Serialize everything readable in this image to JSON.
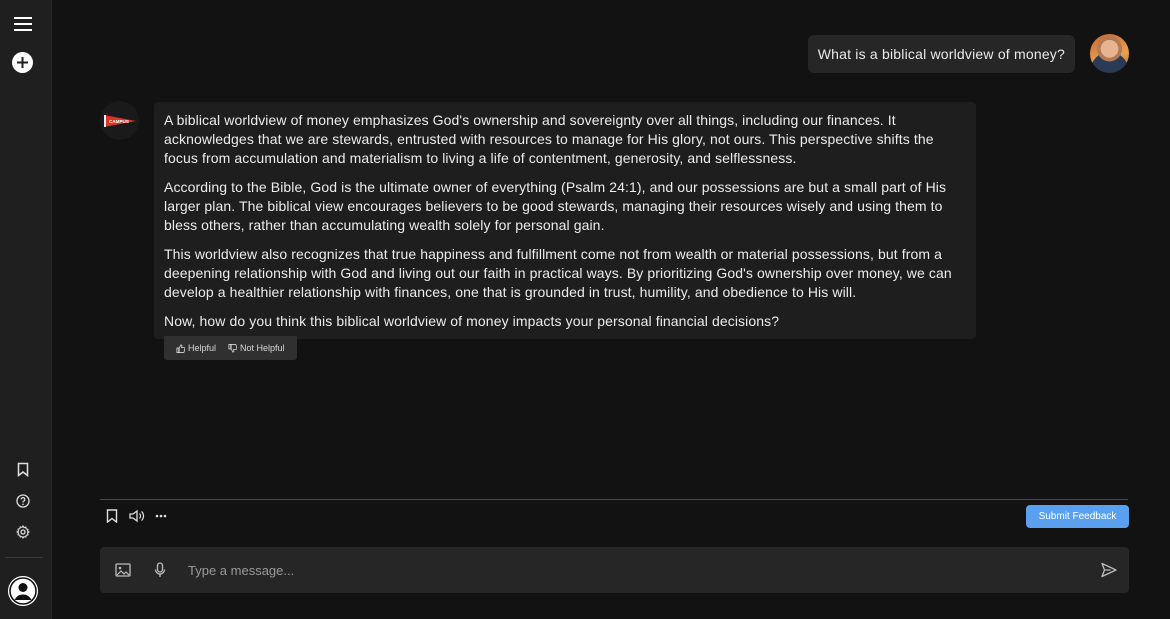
{
  "sidebar": {
    "menu_icon": "hamburger-menu-icon",
    "new_chat_icon": "plus-circle-icon",
    "bookmark_icon": "bookmark-icon",
    "help_icon": "help-circle-icon",
    "settings_icon": "gear-icon",
    "profile_icon": "user-avatar-icon"
  },
  "conversation": {
    "user_message": "What is a biblical worldview of money?",
    "bot_logo_text": "CAMPUS",
    "bot_paragraphs": [
      "A biblical worldview of money emphasizes God's ownership and sovereignty over all things, including our finances. It acknowledges that we are stewards, entrusted with resources to manage for His glory, not ours. This perspective shifts the focus from accumulation and materialism to living a life of contentment, generosity, and selflessness.",
      "According to the Bible, God is the ultimate owner of everything (Psalm 24:1), and our possessions are but a small part of His larger plan. The biblical view encourages believers to be good stewards, managing their resources wisely and using them to bless others, rather than accumulating wealth solely for personal gain.",
      "This worldview also recognizes that true happiness and fulfillment come not from wealth or material possessions, but from a deepening relationship with God and living out our faith in practical ways. By prioritizing God's ownership over money, we can develop a healthier relationship with finances, one that is grounded in trust, humility, and obedience to His will.",
      "Now, how do you think this biblical worldview of money impacts your personal financial decisions?"
    ],
    "feedback": {
      "helpful_label": "Helpful",
      "not_helpful_label": "Not Helpful"
    }
  },
  "toolbar": {
    "bookmark_icon": "bookmark-icon",
    "speaker_icon": "speaker-icon",
    "more_icon": "more-dots-icon",
    "submit_feedback_label": "Submit Feedback"
  },
  "composer": {
    "placeholder": "Type a message...",
    "image_icon": "image-icon",
    "mic_icon": "microphone-icon",
    "send_icon": "send-icon"
  },
  "colors": {
    "background": "#121212",
    "sidebar": "#1f1f1f",
    "bubble": "#1e1e1e",
    "accent": "#5aa0ee"
  }
}
